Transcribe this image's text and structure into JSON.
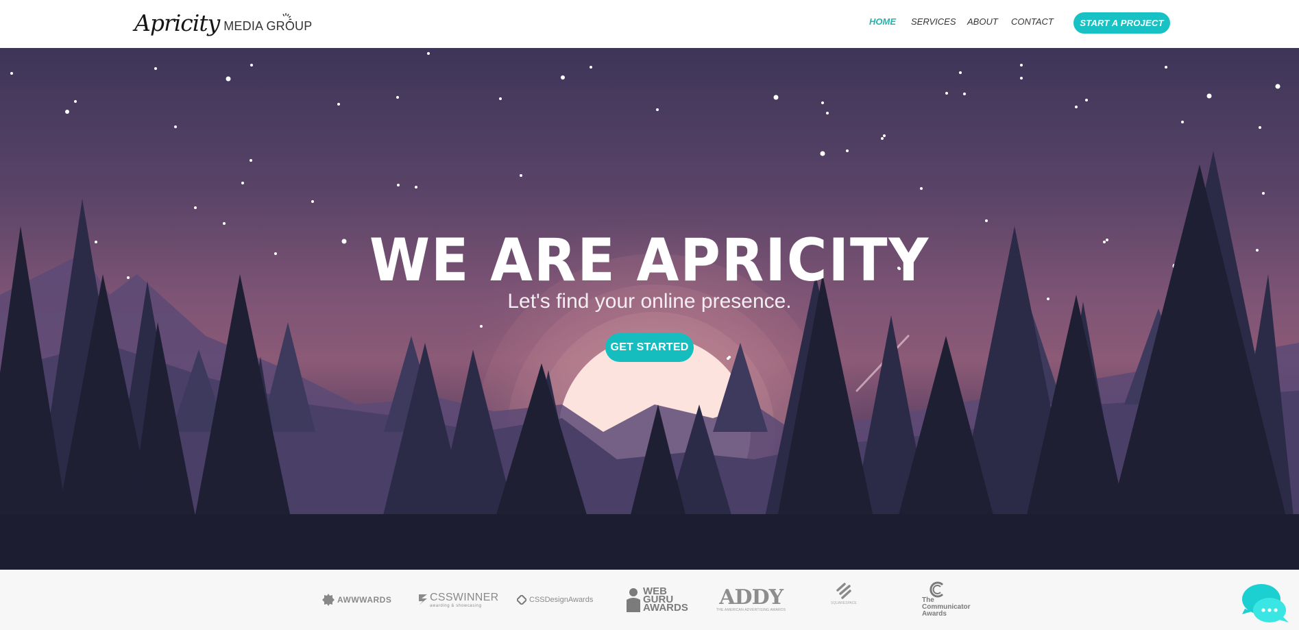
{
  "brand": {
    "script": "Apricity",
    "sub": "MEDIA GROUP"
  },
  "nav": {
    "items": [
      "HOME",
      "SERVICES",
      "ABOUT",
      "CONTACT"
    ],
    "active": "HOME",
    "cta": "START A PROJECT"
  },
  "hero": {
    "title": "WE ARE APRICITY",
    "subtitle": "Let's find your online presence.",
    "button": "GET STARTED"
  },
  "awards": {
    "items": [
      {
        "label": "AWWWARDS"
      },
      {
        "label": "CSSWINNER",
        "tagline": "awarding & showcasing"
      },
      {
        "label": "CSSDesignAwards"
      },
      {
        "label": "WEB GURU AWARDS"
      },
      {
        "label": "ADDY",
        "tagline": "THE AMERICAN ADVERTISING AWARDS"
      },
      {
        "label": "SQUARESPACE"
      },
      {
        "label": "The Communicator Awards"
      }
    ]
  },
  "colors": {
    "accent": "#18c2c4",
    "nav_active": "#21b5ae",
    "chat": "#1ccfd0"
  }
}
